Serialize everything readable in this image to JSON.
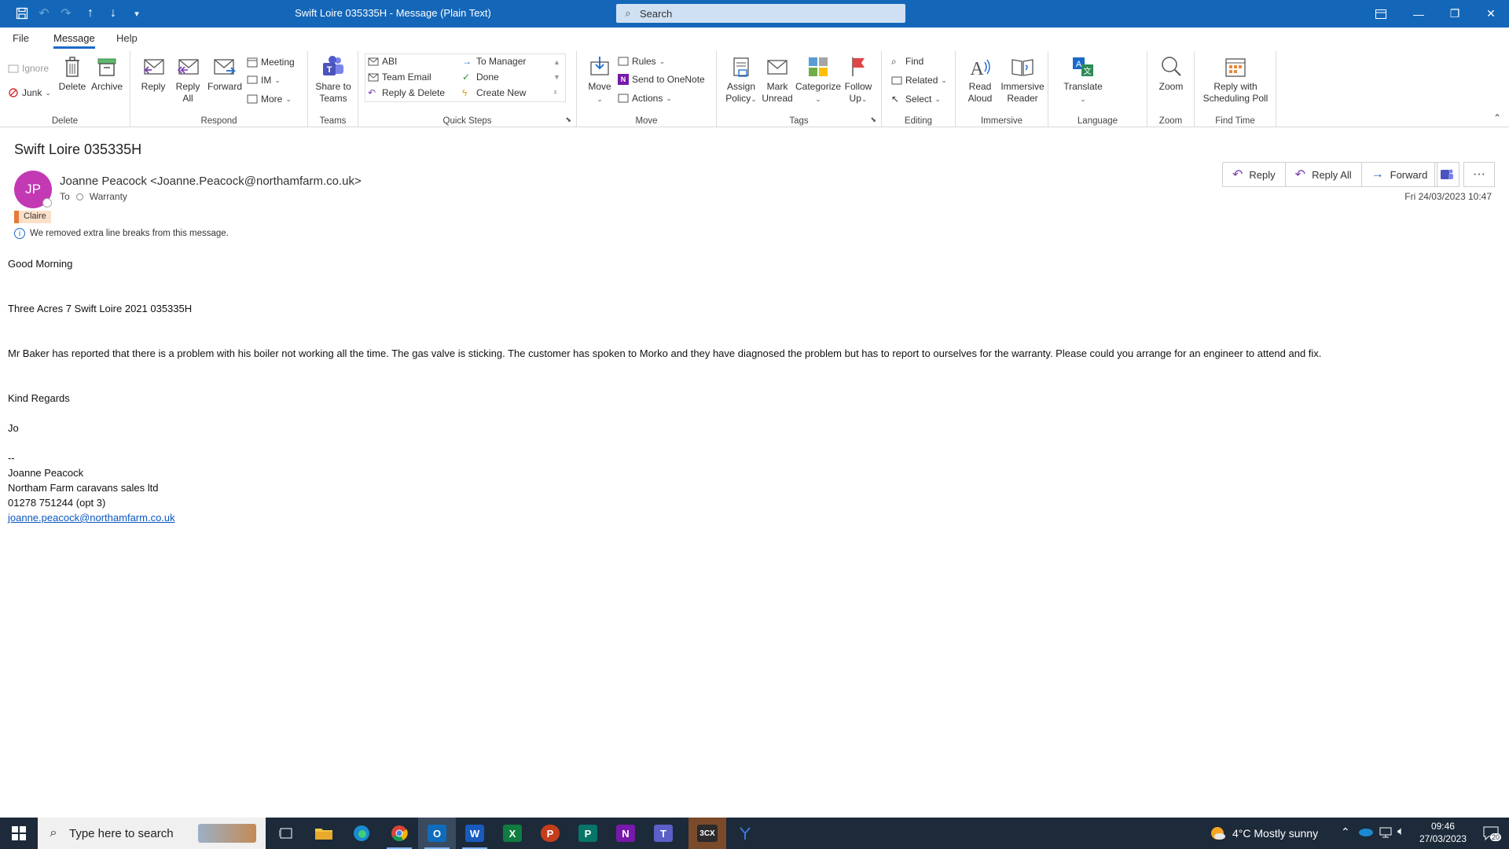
{
  "window": {
    "title": "Swift Loire 035335H  -  Message (Plain Text)",
    "search_placeholder": "Search"
  },
  "menu": {
    "file": "File",
    "message": "Message",
    "help": "Help"
  },
  "ribbon": {
    "delete_group": {
      "label": "Delete",
      "ignore": "Ignore",
      "junk": "Junk",
      "delete": "Delete",
      "archive": "Archive"
    },
    "respond_group": {
      "label": "Respond",
      "reply": "Reply",
      "reply_all_1": "Reply",
      "reply_all_2": "All",
      "forward": "Forward",
      "meeting": "Meeting",
      "im": "IM",
      "more": "More"
    },
    "teams_group": {
      "label": "Teams",
      "share_1": "Share to",
      "share_2": "Teams"
    },
    "quicksteps_group": {
      "label": "Quick Steps",
      "abi": "ABI",
      "team_email": "Team Email",
      "reply_delete": "Reply & Delete",
      "to_manager": "To Manager",
      "done": "Done",
      "create_new": "Create New"
    },
    "move_group": {
      "label": "Move",
      "move": "Move",
      "rules": "Rules",
      "onenote": "Send to OneNote",
      "actions": "Actions"
    },
    "tags_group": {
      "label": "Tags",
      "assign_1": "Assign",
      "assign_2": "Policy",
      "mark_1": "Mark",
      "mark_2": "Unread",
      "categorize": "Categorize",
      "follow_1": "Follow",
      "follow_2": "Up"
    },
    "editing_group": {
      "label": "Editing",
      "find": "Find",
      "related": "Related",
      "select": "Select"
    },
    "immersive_group": {
      "label": "Immersive",
      "read_1": "Read",
      "read_2": "Aloud",
      "imm_1": "Immersive",
      "imm_2": "Reader"
    },
    "language_group": {
      "label": "Language",
      "translate": "Translate"
    },
    "zoom_group": {
      "label": "Zoom",
      "zoom": "Zoom"
    },
    "findtime_group": {
      "label": "Find Time",
      "reply_poll_1": "Reply with",
      "reply_poll_2": "Scheduling Poll"
    }
  },
  "message": {
    "subject": "Swift Loire 035335H",
    "avatar_initials": "JP",
    "sender": "Joanne Peacock <Joanne.Peacock@northamfarm.co.uk>",
    "to_label": "To",
    "to_value": "Warranty",
    "category": "Claire",
    "info": "We removed extra line breaks from this message.",
    "date": "Fri 24/03/2023 10:47",
    "actions": {
      "reply": "Reply",
      "reply_all": "Reply All",
      "forward": "Forward"
    },
    "body": {
      "greeting": "Good Morning",
      "reference": "Three Acres 7 Swift Loire  2021 035335H",
      "paragraph": "Mr Baker has reported that there is a problem with his boiler not working all the time. The gas valve is sticking. The customer has spoken to Morko and they have diagnosed the problem but has to report to ourselves for the warranty. Please could you arrange for an engineer to attend and fix.",
      "closing": "Kind Regards",
      "signoff": "Jo",
      "sig_sep": "--",
      "sig_name": "Joanne Peacock",
      "sig_company": "Northam Farm caravans sales ltd",
      "sig_phone": "01278 751244 (opt 3)",
      "sig_email": "joanne.peacock@northamfarm.co.uk"
    }
  },
  "taskbar": {
    "search_placeholder": "Type here to search",
    "weather": "4°C  Mostly sunny",
    "time": "09:46",
    "date": "27/03/2023",
    "notifications": "20",
    "app_3cx": "3CX"
  }
}
